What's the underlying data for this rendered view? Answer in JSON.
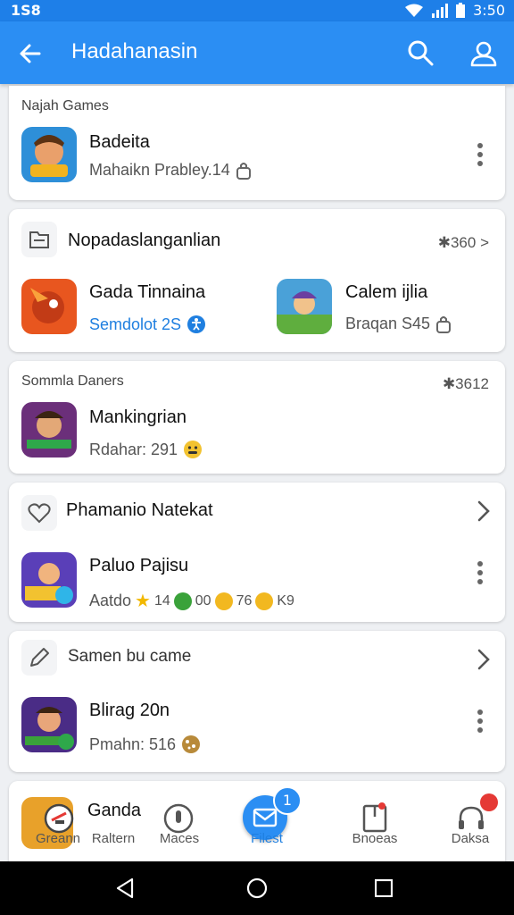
{
  "status_bar": {
    "time": "1S8",
    "clock": "3:50"
  },
  "app_bar": {
    "title": "Hadahanasin",
    "back_icon": "arrow-left-icon",
    "search_icon": "search-icon",
    "account_icon": "account-icon"
  },
  "card1": {
    "label": "Najah Games",
    "game": {
      "name": "Badeita",
      "sub": "Mahaikn Prabley.14"
    }
  },
  "card2": {
    "title": "Nopadaslanganlian",
    "meta": "✱360 >",
    "games": [
      {
        "name": "Gada Tinnaina",
        "sub": "Semdolot 2S"
      },
      {
        "name": "Calem ijlia",
        "sub": "Braqan S45"
      }
    ]
  },
  "card3": {
    "label": "Sommla Daners",
    "meta": "✱3612",
    "game": {
      "name": "Mankingrian",
      "sub": "Rdahar: 291"
    }
  },
  "card4": {
    "title": "Phamanio Natekat",
    "game": {
      "name": "Paluo Pajisu",
      "sub_prefix": "Aatdo",
      "v1": "14",
      "v2": "00",
      "v3": "76",
      "v4": "K9"
    }
  },
  "card5": {
    "title": "Samen bu came",
    "game": {
      "name": "Blirag 20n",
      "sub": "Pmahn: 516"
    }
  },
  "card6": {
    "game": {
      "name": "Ganda"
    }
  },
  "bottom_nav": {
    "items": [
      {
        "label": "Greann",
        "icon": "gamepad-icon"
      },
      {
        "label": "Raltern",
        "icon": "none"
      },
      {
        "label": "Maces",
        "icon": "compass-icon"
      },
      {
        "label": "Filest",
        "icon": "mail-icon",
        "badge": "1"
      },
      {
        "label": "Bnoeas",
        "icon": "bookmark-icon"
      },
      {
        "label": "Daksa",
        "icon": "headset-icon"
      }
    ]
  },
  "colors": {
    "primary": "#2b8ef3",
    "status": "#1e7fe8",
    "link": "#1f7fe0",
    "badge_red": "#e53935"
  }
}
